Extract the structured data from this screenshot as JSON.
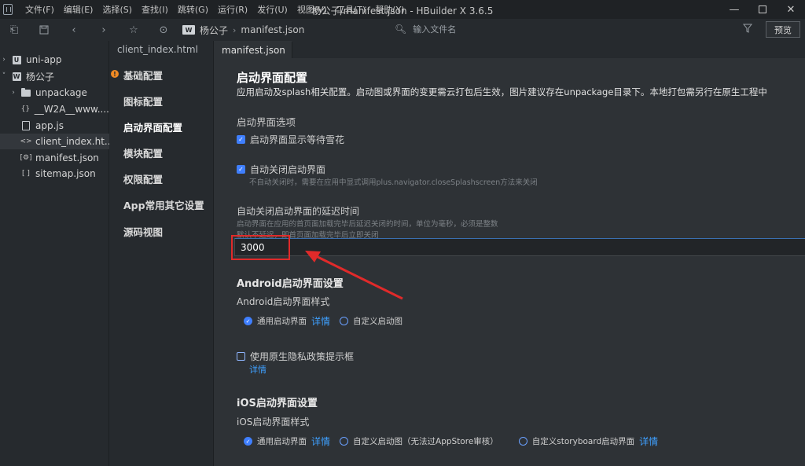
{
  "menu": [
    "文件(F)",
    "编辑(E)",
    "选择(S)",
    "查找(I)",
    "跳转(G)",
    "运行(R)",
    "发行(U)",
    "视图(V)",
    "工具(T)",
    "帮助(Y)"
  ],
  "window": {
    "title": "杨公子/manifest.json - HBuilder X 3.6.5"
  },
  "toolbar": {
    "breadcrumb_project": "杨公子",
    "breadcrumb_file": "manifest.json",
    "file_search_placeholder": "输入文件名",
    "preview_label": "预览"
  },
  "tree": {
    "items": [
      {
        "label": "uni-app"
      },
      {
        "label": "杨公子"
      },
      {
        "label": "unpackage"
      },
      {
        "label": "__W2A__www...."
      },
      {
        "label": "app.js"
      },
      {
        "label": "client_index.ht..."
      },
      {
        "label": "manifest.json"
      },
      {
        "label": "sitemap.json"
      }
    ]
  },
  "tabs": [
    {
      "label": "client_index.html"
    },
    {
      "label": "manifest.json"
    }
  ],
  "settings_nav": {
    "items": [
      {
        "label": "基础配置"
      },
      {
        "label": "图标配置"
      },
      {
        "label": "启动界面配置"
      },
      {
        "label": "模块配置"
      },
      {
        "label": "权限配置"
      },
      {
        "label": "App常用其它设置"
      },
      {
        "label": "源码视图"
      }
    ]
  },
  "splash": {
    "title": "启动界面配置",
    "description": "应用启动及splash相关配置。启动图或界面的变更需云打包后生效，图片建议存在unpackage目录下。本地打包需另行在原生工程中",
    "options_heading": "启动界面选项",
    "waiting_snow_label": "启动界面显示等待雪花",
    "auto_close_label": "自动关闭启动界面",
    "auto_close_hint": "不自动关闭时，需要在应用中显式调用plus.navigator.closeSplashscreen方法来关闭",
    "delay_heading": "自动关闭启动界面的延迟时间",
    "delay_hint_1": "启动界面在应用的首页面加载完毕后延迟关闭的时间，单位为毫秒，必须是整数",
    "delay_hint_2": "默认不延迟，即首页面加载完毕后立即关闭",
    "delay_value": "3000"
  },
  "android": {
    "heading": "Android启动界面设置",
    "style_label": "Android启动界面样式",
    "option_common": "通用启动界面",
    "option_common_link": "详情",
    "option_custom": "自定义启动图",
    "privacy_label": "使用原生隐私政策提示框",
    "privacy_link": "详情"
  },
  "ios": {
    "heading": "iOS启动界面设置",
    "style_label": "iOS启动界面样式",
    "option_common": "通用启动界面",
    "option_common_link": "详情",
    "option_custom": "自定义启动图（无法过AppStore审核）",
    "option_storyboard": "自定义storyboard启动界面",
    "option_storyboard_link": "详情"
  }
}
